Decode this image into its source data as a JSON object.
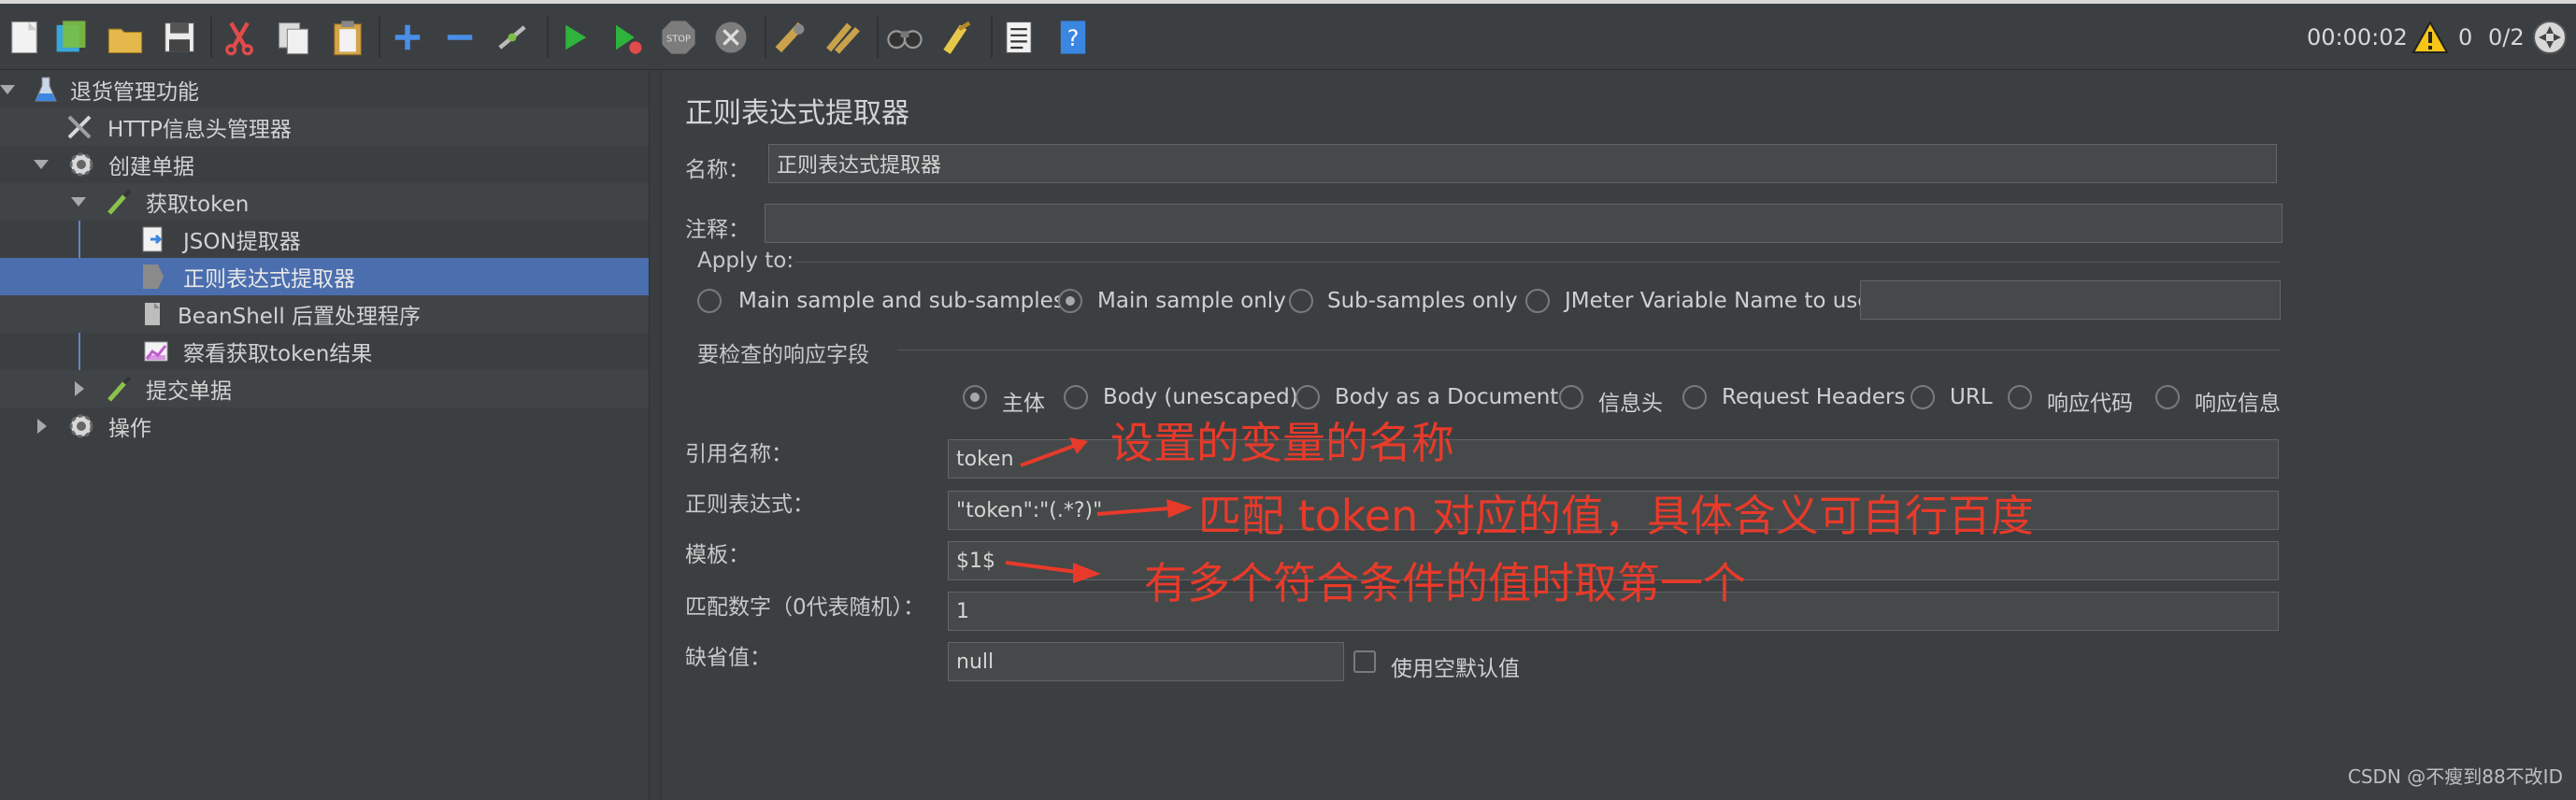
{
  "toolbar": {
    "buttons": [
      "new-icon",
      "templates-icon",
      "open-icon",
      "save-icon",
      "cut-icon",
      "copy-icon",
      "paste-icon",
      "expand-icon",
      "collapse-icon",
      "toggle-icon",
      "start-icon",
      "start-no-pause-icon",
      "stop-icon",
      "shutdown-icon",
      "clear-icon",
      "clear-all-icon",
      "search-icon",
      "reset-search-icon",
      "function-helper-icon",
      "help-icon"
    ],
    "timer": "00:00:02",
    "warnings": "0",
    "threads": "0/2"
  },
  "tree": {
    "items": [
      {
        "label": "退货管理功能",
        "icon": "test-plan-icon"
      },
      {
        "label": "HTTP信息头管理器",
        "icon": "tools-icon"
      },
      {
        "label": "创建单据",
        "icon": "gear-icon"
      },
      {
        "label": "获取token",
        "icon": "sampler-pipette-icon"
      },
      {
        "label": "JSON提取器",
        "icon": "json-extractor-icon"
      },
      {
        "label": "正则表达式提取器",
        "icon": "regex-extractor-icon"
      },
      {
        "label": "BeanShell 后置处理程序",
        "icon": "beanshell-icon"
      },
      {
        "label": "察看获取token结果",
        "icon": "listener-chart-icon"
      },
      {
        "label": "提交单据",
        "icon": "sampler-pipette-icon"
      },
      {
        "label": "操作",
        "icon": "gear-icon"
      }
    ]
  },
  "panel": {
    "title": "正则表达式提取器",
    "name_label": "名称：",
    "name_value": "正则表达式提取器",
    "comment_label": "注释：",
    "comment_value": "",
    "apply_to_label": "Apply to:",
    "apply_options": [
      "Main sample and sub-samples",
      "Main sample only",
      "Sub-samples only",
      "JMeter Variable Name to use"
    ],
    "apply_selected": "Main sample only",
    "apply_var_value": "",
    "field_section_label": "要检查的响应字段",
    "field_options": [
      "主体",
      "Body (unescaped)",
      "Body as a Document",
      "信息头",
      "Request Headers",
      "URL",
      "响应代码",
      "响应信息"
    ],
    "field_selected": "主体",
    "ref_label": "引用名称：",
    "ref_value": "token",
    "regex_label": "正则表达式：",
    "regex_value": "\"token\":\"(.*?)\"",
    "template_label": "模板：",
    "template_value": "$1$",
    "match_label": "匹配数字（0代表随机）：",
    "match_value": "1",
    "default_label": "缺省值：",
    "default_value": "null",
    "use_empty_label": "使用空默认值"
  },
  "annotations": {
    "a1": "设置的变量的名称",
    "a2": "匹配 token 对应的值，具体含义可自行百度",
    "a3": "有多个符合条件的值时取第一个",
    "color": "#e83a2a"
  },
  "watermark": "CSDN @不瘦到88不改ID"
}
